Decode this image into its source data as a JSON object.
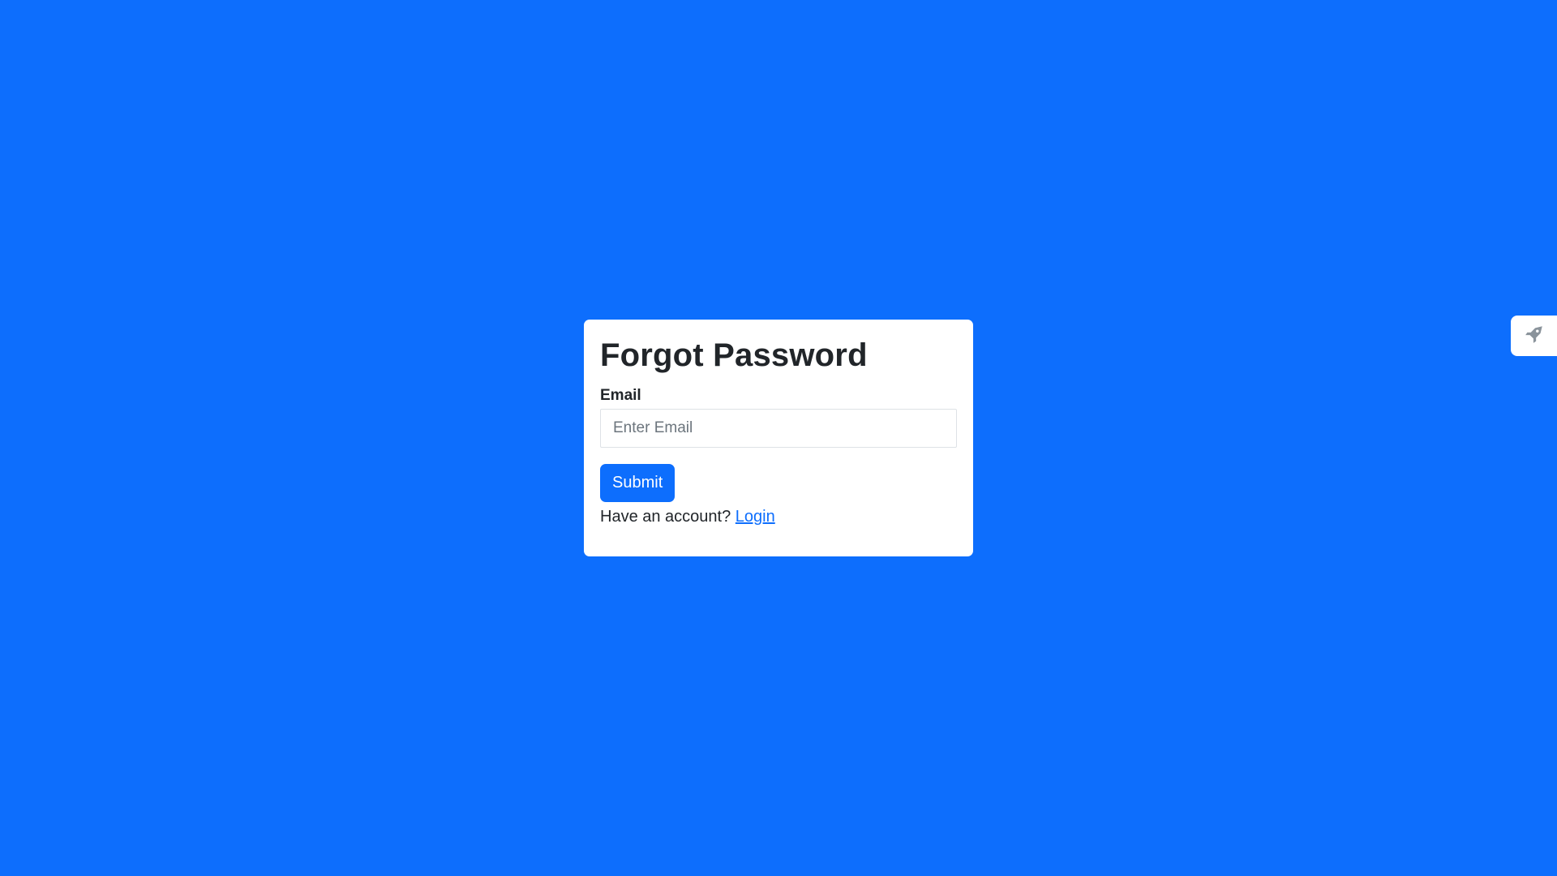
{
  "form": {
    "title": "Forgot Password",
    "email_label": "Email",
    "email_placeholder": "Enter Email",
    "email_value": "",
    "submit_label": "Submit",
    "footer_prefix": "Have an account?",
    "login_link": "Login"
  },
  "side_widget": {
    "icon": "rocket-icon"
  },
  "colors": {
    "background": "#0d6efd",
    "card": "#ffffff",
    "primary": "#0d6efd",
    "text": "#212529",
    "placeholder": "#6c757d",
    "icon": "#8a939b"
  }
}
